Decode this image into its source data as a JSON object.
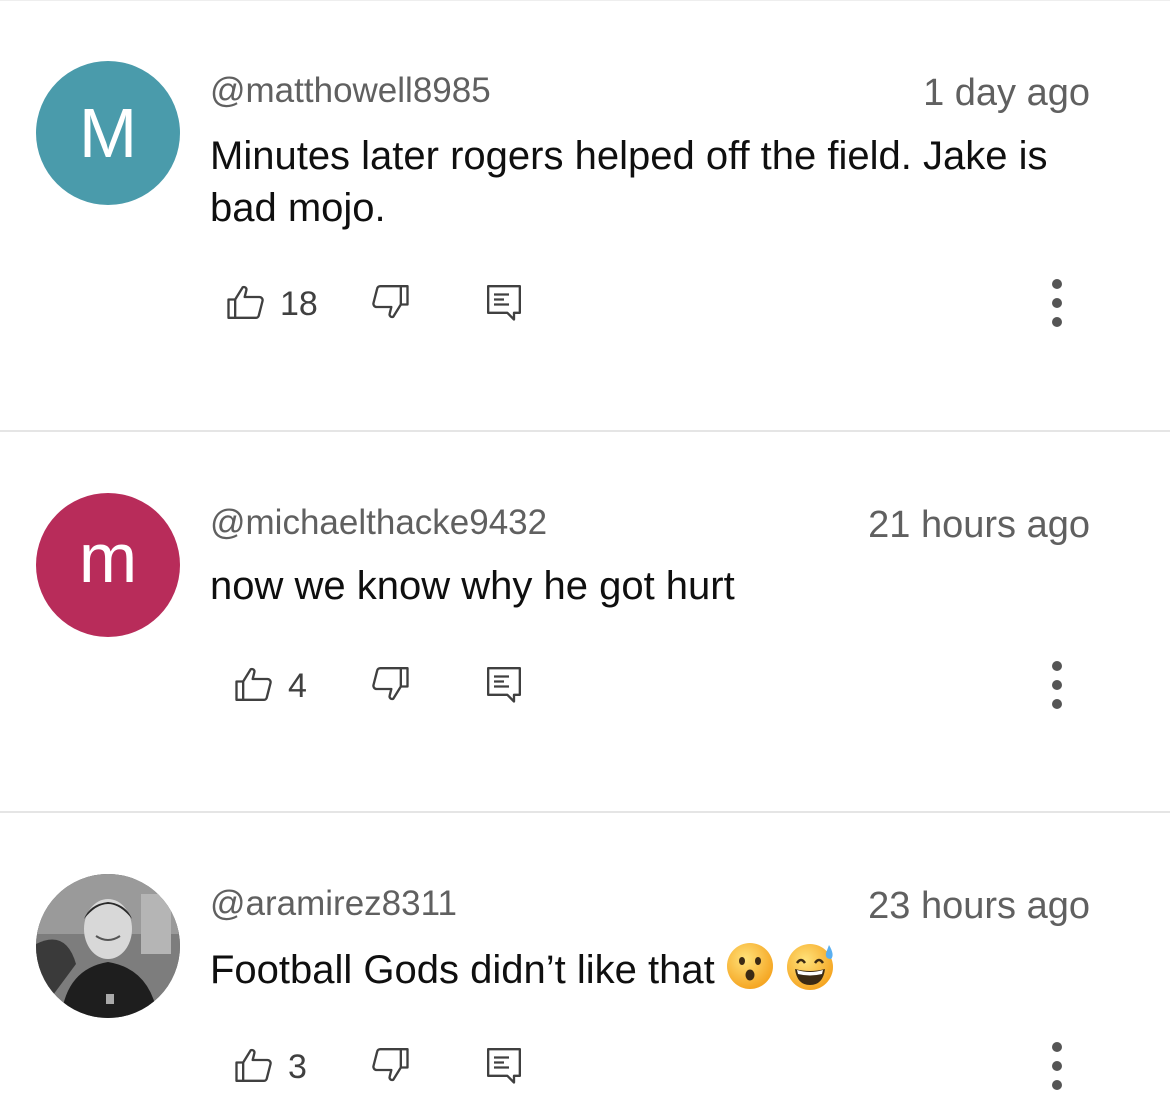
{
  "comments": [
    {
      "avatar_letter": "M",
      "avatar_color": "#4a9bab",
      "handle": "@matthowell8985",
      "time": "1 day ago",
      "text": "Minutes later rogers helped off the field. Jake is bad mojo.",
      "likes": "18"
    },
    {
      "avatar_letter": "m",
      "avatar_color": "#b82c5a",
      "handle": "@michaelthacke9432",
      "time": "21 hours ago",
      "text": "now we know why he got hurt",
      "likes": "4"
    },
    {
      "avatar_letter": "",
      "avatar_color": "#6a6a6a",
      "handle": "@aramirez8311",
      "time": "23 hours ago",
      "text": "Football Gods didn’t like that",
      "likes": "3",
      "emojis": [
        "hushed-face-emoji",
        "grinning-face-with-sweat-emoji"
      ]
    }
  ],
  "icons": {
    "like": "thumbs-up-icon",
    "dislike": "thumbs-down-icon",
    "reply": "reply-comment-icon",
    "more": "more-vertical-icon"
  }
}
